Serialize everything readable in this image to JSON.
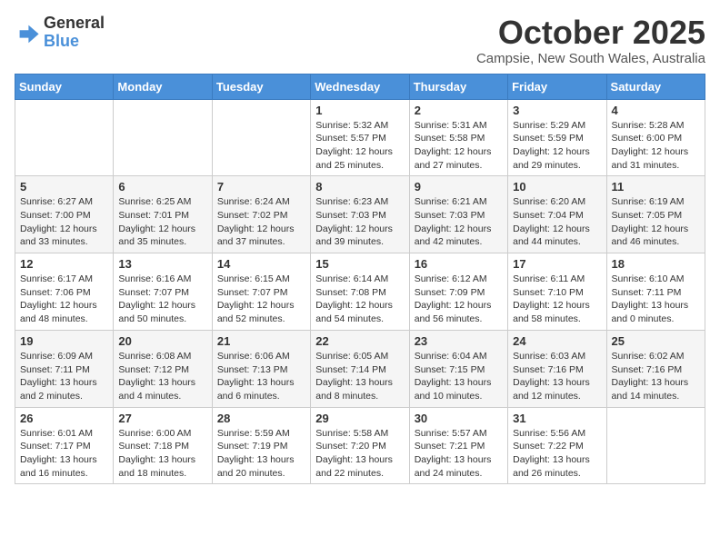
{
  "logo": {
    "general": "General",
    "blue": "Blue"
  },
  "header": {
    "month": "October 2025",
    "location": "Campsie, New South Wales, Australia"
  },
  "weekdays": [
    "Sunday",
    "Monday",
    "Tuesday",
    "Wednesday",
    "Thursday",
    "Friday",
    "Saturday"
  ],
  "weeks": [
    [
      {
        "day": "",
        "info": ""
      },
      {
        "day": "",
        "info": ""
      },
      {
        "day": "",
        "info": ""
      },
      {
        "day": "1",
        "info": "Sunrise: 5:32 AM\nSunset: 5:57 PM\nDaylight: 12 hours\nand 25 minutes."
      },
      {
        "day": "2",
        "info": "Sunrise: 5:31 AM\nSunset: 5:58 PM\nDaylight: 12 hours\nand 27 minutes."
      },
      {
        "day": "3",
        "info": "Sunrise: 5:29 AM\nSunset: 5:59 PM\nDaylight: 12 hours\nand 29 minutes."
      },
      {
        "day": "4",
        "info": "Sunrise: 5:28 AM\nSunset: 6:00 PM\nDaylight: 12 hours\nand 31 minutes."
      }
    ],
    [
      {
        "day": "5",
        "info": "Sunrise: 6:27 AM\nSunset: 7:00 PM\nDaylight: 12 hours\nand 33 minutes."
      },
      {
        "day": "6",
        "info": "Sunrise: 6:25 AM\nSunset: 7:01 PM\nDaylight: 12 hours\nand 35 minutes."
      },
      {
        "day": "7",
        "info": "Sunrise: 6:24 AM\nSunset: 7:02 PM\nDaylight: 12 hours\nand 37 minutes."
      },
      {
        "day": "8",
        "info": "Sunrise: 6:23 AM\nSunset: 7:03 PM\nDaylight: 12 hours\nand 39 minutes."
      },
      {
        "day": "9",
        "info": "Sunrise: 6:21 AM\nSunset: 7:03 PM\nDaylight: 12 hours\nand 42 minutes."
      },
      {
        "day": "10",
        "info": "Sunrise: 6:20 AM\nSunset: 7:04 PM\nDaylight: 12 hours\nand 44 minutes."
      },
      {
        "day": "11",
        "info": "Sunrise: 6:19 AM\nSunset: 7:05 PM\nDaylight: 12 hours\nand 46 minutes."
      }
    ],
    [
      {
        "day": "12",
        "info": "Sunrise: 6:17 AM\nSunset: 7:06 PM\nDaylight: 12 hours\nand 48 minutes."
      },
      {
        "day": "13",
        "info": "Sunrise: 6:16 AM\nSunset: 7:07 PM\nDaylight: 12 hours\nand 50 minutes."
      },
      {
        "day": "14",
        "info": "Sunrise: 6:15 AM\nSunset: 7:07 PM\nDaylight: 12 hours\nand 52 minutes."
      },
      {
        "day": "15",
        "info": "Sunrise: 6:14 AM\nSunset: 7:08 PM\nDaylight: 12 hours\nand 54 minutes."
      },
      {
        "day": "16",
        "info": "Sunrise: 6:12 AM\nSunset: 7:09 PM\nDaylight: 12 hours\nand 56 minutes."
      },
      {
        "day": "17",
        "info": "Sunrise: 6:11 AM\nSunset: 7:10 PM\nDaylight: 12 hours\nand 58 minutes."
      },
      {
        "day": "18",
        "info": "Sunrise: 6:10 AM\nSunset: 7:11 PM\nDaylight: 13 hours\nand 0 minutes."
      }
    ],
    [
      {
        "day": "19",
        "info": "Sunrise: 6:09 AM\nSunset: 7:11 PM\nDaylight: 13 hours\nand 2 minutes."
      },
      {
        "day": "20",
        "info": "Sunrise: 6:08 AM\nSunset: 7:12 PM\nDaylight: 13 hours\nand 4 minutes."
      },
      {
        "day": "21",
        "info": "Sunrise: 6:06 AM\nSunset: 7:13 PM\nDaylight: 13 hours\nand 6 minutes."
      },
      {
        "day": "22",
        "info": "Sunrise: 6:05 AM\nSunset: 7:14 PM\nDaylight: 13 hours\nand 8 minutes."
      },
      {
        "day": "23",
        "info": "Sunrise: 6:04 AM\nSunset: 7:15 PM\nDaylight: 13 hours\nand 10 minutes."
      },
      {
        "day": "24",
        "info": "Sunrise: 6:03 AM\nSunset: 7:16 PM\nDaylight: 13 hours\nand 12 minutes."
      },
      {
        "day": "25",
        "info": "Sunrise: 6:02 AM\nSunset: 7:16 PM\nDaylight: 13 hours\nand 14 minutes."
      }
    ],
    [
      {
        "day": "26",
        "info": "Sunrise: 6:01 AM\nSunset: 7:17 PM\nDaylight: 13 hours\nand 16 minutes."
      },
      {
        "day": "27",
        "info": "Sunrise: 6:00 AM\nSunset: 7:18 PM\nDaylight: 13 hours\nand 18 minutes."
      },
      {
        "day": "28",
        "info": "Sunrise: 5:59 AM\nSunset: 7:19 PM\nDaylight: 13 hours\nand 20 minutes."
      },
      {
        "day": "29",
        "info": "Sunrise: 5:58 AM\nSunset: 7:20 PM\nDaylight: 13 hours\nand 22 minutes."
      },
      {
        "day": "30",
        "info": "Sunrise: 5:57 AM\nSunset: 7:21 PM\nDaylight: 13 hours\nand 24 minutes."
      },
      {
        "day": "31",
        "info": "Sunrise: 5:56 AM\nSunset: 7:22 PM\nDaylight: 13 hours\nand 26 minutes."
      },
      {
        "day": "",
        "info": ""
      }
    ]
  ]
}
